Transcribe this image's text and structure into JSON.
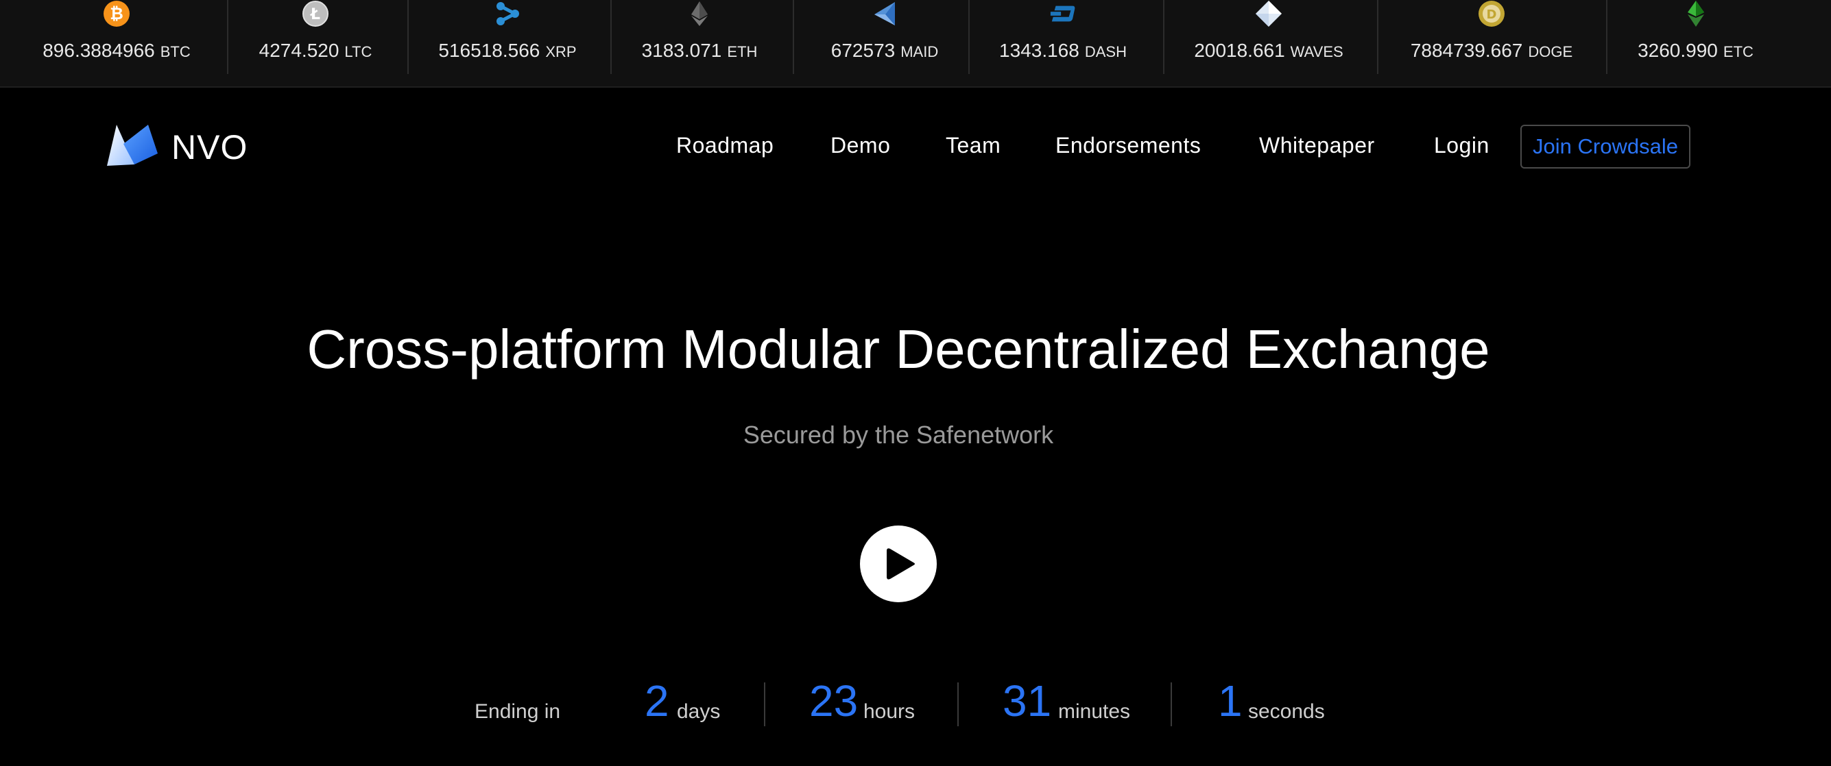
{
  "ticker": [
    {
      "value": "896.3884966",
      "symbol": "BTC",
      "icon": "bitcoin-icon",
      "color": "#f7931a"
    },
    {
      "value": "4274.520",
      "symbol": "LTC",
      "icon": "litecoin-icon",
      "color": "#bebebe"
    },
    {
      "value": "516518.566",
      "symbol": "XRP",
      "icon": "ripple-icon",
      "color": "#2b8fd6"
    },
    {
      "value": "3183.071",
      "symbol": "ETH",
      "icon": "ethereum-icon",
      "color": "#6c6c6c"
    },
    {
      "value": "672573",
      "symbol": "MAID",
      "icon": "maidsafe-icon",
      "color": "#5592d7"
    },
    {
      "value": "1343.168",
      "symbol": "DASH",
      "icon": "dash-icon",
      "color": "#1c75bc"
    },
    {
      "value": "20018.661",
      "symbol": "WAVES",
      "icon": "waves-icon",
      "color": "#dfe9f5"
    },
    {
      "value": "7884739.667",
      "symbol": "DOGE",
      "icon": "dogecoin-icon",
      "color": "#c2a633"
    },
    {
      "value": "3260.990",
      "symbol": "ETC",
      "icon": "ethereum-classic-icon",
      "color": "#3ab83a"
    }
  ],
  "brand": {
    "name": "NVO"
  },
  "nav": {
    "roadmap": "Roadmap",
    "demo": "Demo",
    "team": "Team",
    "endorsements": "Endorsements",
    "whitepaper": "Whitepaper",
    "login": "Login",
    "join": "Join Crowdsale"
  },
  "hero": {
    "headline": "Cross-platform Modular Decentralized Exchange",
    "subline": "Secured by the Safenetwork"
  },
  "countdown": {
    "label": "Ending in",
    "days": {
      "value": "2",
      "unit": "days"
    },
    "hours": {
      "value": "23",
      "unit": "hours"
    },
    "minutes": {
      "value": "31",
      "unit": "minutes"
    },
    "seconds": {
      "value": "1",
      "unit": "seconds"
    }
  },
  "colors": {
    "accent": "#2b74f5",
    "background": "#000000",
    "ticker_bg": "#111111"
  }
}
